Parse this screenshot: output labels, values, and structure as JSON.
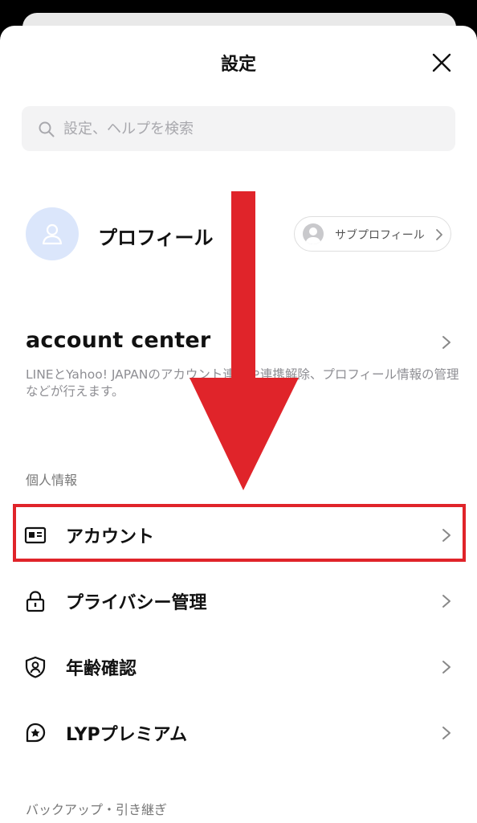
{
  "header": {
    "title": "設定"
  },
  "search": {
    "placeholder": "設定、ヘルプを検索"
  },
  "profile": {
    "label": "プロフィール",
    "subprofile_label": "サブプロフィール"
  },
  "account_center": {
    "title": "account center",
    "description": "LINEとYahoo! JAPANのアカウント連携や連携解除、プロフィール情報の管理などが行えます。"
  },
  "sections": {
    "personal_info": "個人情報",
    "backup": "バックアップ・引き継ぎ"
  },
  "items": [
    {
      "label": "アカウント",
      "icon": "id-card-icon"
    },
    {
      "label": "プライバシー管理",
      "icon": "lock-icon"
    },
    {
      "label": "年齢確認",
      "icon": "shield-user-icon"
    },
    {
      "label": "LYPプレミアム",
      "icon": "premium-icon"
    }
  ],
  "colors": {
    "accent_red": "#e0242a",
    "avatar_bg": "#dbe6fb",
    "search_bg": "#f3f3f4"
  }
}
